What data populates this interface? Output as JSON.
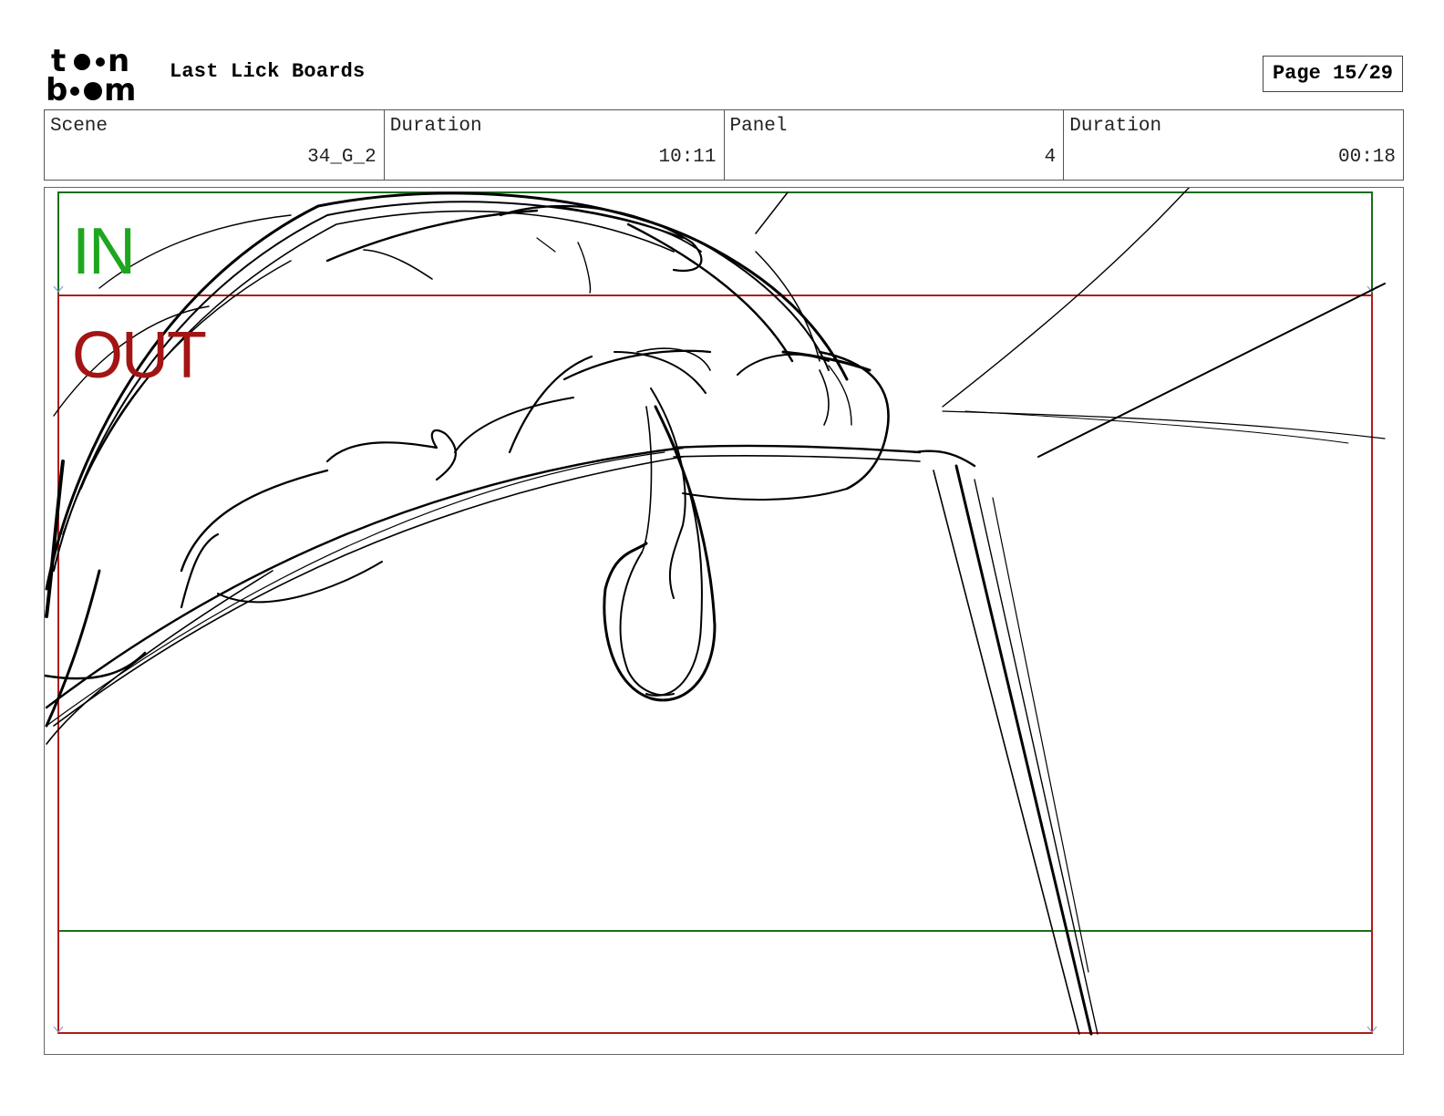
{
  "header": {
    "logo": "toon boom",
    "title": "Last Lick Boards",
    "page": "Page 15/29"
  },
  "info": {
    "scene_label": "Scene",
    "scene_value": "34_G_2",
    "scene_duration_label": "Duration",
    "scene_duration_value": "10:11",
    "panel_label": "Panel",
    "panel_value": "4",
    "panel_duration_label": "Duration",
    "panel_duration_value": "00:18"
  },
  "panel": {
    "in_label": "IN",
    "out_label": "OUT",
    "colors": {
      "in_frame": "#1a6e1a",
      "in_text": "#1fa61f",
      "out_frame": "#b01c1c",
      "out_text": "#a31414",
      "sketch": "#000000"
    }
  }
}
